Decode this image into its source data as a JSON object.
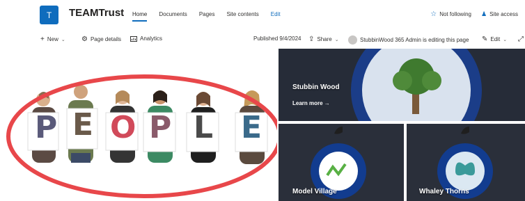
{
  "site": {
    "logo_letter": "T",
    "title": "TEAMTrust"
  },
  "nav": {
    "items": [
      {
        "label": "Home",
        "active": true
      },
      {
        "label": "Documents",
        "active": false
      },
      {
        "label": "Pages",
        "active": false
      },
      {
        "label": "Site contents",
        "active": false
      },
      {
        "label": "Edit",
        "active": false
      }
    ]
  },
  "header_right": {
    "follow_label": "Not following",
    "site_access_label": "Site access"
  },
  "command_bar": {
    "new_label": "New",
    "page_details_label": "Page details",
    "analytics_label": "Analytics",
    "published_label": "Published 9/4/2024",
    "share_label": "Share",
    "editing_label": "StubbinWood 365 Admin is editing this page",
    "edit_label": "Edit"
  },
  "hero": {
    "people_letters": [
      "P",
      "E",
      "O",
      "P",
      "L",
      "E"
    ],
    "tiles": [
      {
        "title": "Stubbin Wood",
        "link": "Learn more →"
      },
      {
        "title": "Model Village",
        "link": ""
      },
      {
        "title": "Whaley Thorns",
        "link": ""
      }
    ]
  },
  "colors": {
    "accent": "#0f6cbd",
    "annotation_ellipse": "#e8474a",
    "tile_bg": "#242b39",
    "blue_circle": "#123c8f"
  },
  "icons": {
    "follow": "star-icon",
    "site_access": "people-icon",
    "new": "plus-icon",
    "page_details": "gear-icon",
    "analytics": "analytics-icon",
    "share": "share-icon",
    "edit": "pencil-icon"
  }
}
